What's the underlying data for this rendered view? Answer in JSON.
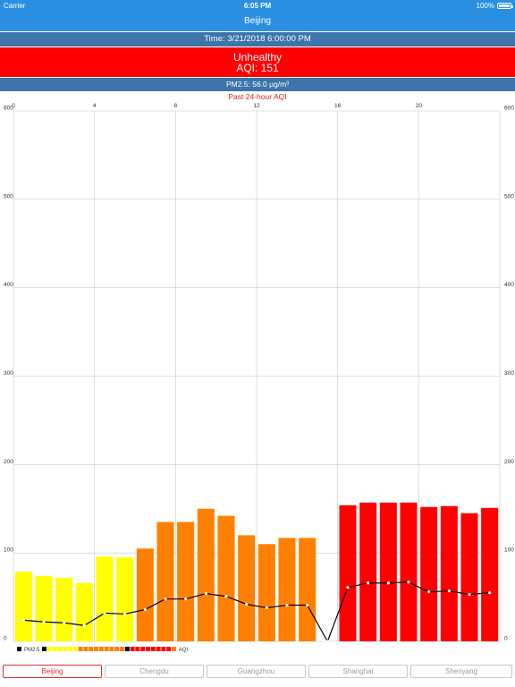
{
  "status_bar": {
    "carrier": "Carrier",
    "time": "6:05 PM",
    "battery": "100%"
  },
  "nav": {
    "title": "Beijing"
  },
  "time_bar": {
    "text": "Time: 3/21/2018 6:00:00 PM"
  },
  "level": {
    "label": "Unhealthy",
    "aqi": "AQI: 151",
    "color": "#ff0000"
  },
  "pm_bar": {
    "text": "PM2.5: 56.0 μg/m³"
  },
  "chart_title": "Past 24-hour AQI",
  "colors": {
    "header_blue": "#2a8fe0",
    "bar_blue": "#3c74ab",
    "good": "#ffff00",
    "moderate": "#ff8000",
    "unhealthy": "#ff0000",
    "accent_red": "#e03030"
  },
  "chart_data": {
    "type": "bar",
    "title": "Past 24-hour AQI",
    "x_ticks": [
      "0",
      "4",
      "8",
      "12",
      "16",
      "20"
    ],
    "y_ticks": [
      "0",
      "100",
      "200",
      "300",
      "400",
      "500",
      "600"
    ],
    "xlim": [
      0,
      24
    ],
    "ylim": [
      0,
      600
    ],
    "grid": true,
    "legend_position": "bottom-left",
    "series": [
      {
        "name": "AQI",
        "type": "bar",
        "x": [
          0,
          1,
          2,
          3,
          4,
          5,
          6,
          7,
          8,
          9,
          10,
          11,
          12,
          13,
          14,
          15,
          16,
          17,
          18,
          19,
          20,
          21,
          22,
          23
        ],
        "values": [
          79,
          74,
          72,
          66,
          96,
          95,
          105,
          135,
          135,
          150,
          142,
          120,
          110,
          117,
          117,
          0,
          154,
          157,
          157,
          157,
          152,
          153,
          145,
          151
        ],
        "colors": [
          "#ffff00",
          "#ffff00",
          "#ffff00",
          "#ffff00",
          "#ffff00",
          "#ffff00",
          "#ff8000",
          "#ff8000",
          "#ff8000",
          "#ff8000",
          "#ff8000",
          "#ff8000",
          "#ff8000",
          "#ff8000",
          "#ff8000",
          "#ff0000",
          "#ff0000",
          "#ff0000",
          "#ff0000",
          "#ff0000",
          "#ff0000",
          "#ff0000",
          "#ff0000",
          "#ff0000"
        ]
      },
      {
        "name": "PM2.5",
        "type": "line",
        "x": [
          0,
          1,
          2,
          3,
          4,
          5,
          6,
          7,
          8,
          9,
          10,
          11,
          12,
          13,
          14,
          15,
          16,
          17,
          18,
          19,
          20,
          21,
          22,
          23
        ],
        "values": [
          24,
          22,
          21,
          18,
          32,
          31,
          36,
          48,
          48,
          54,
          51,
          42,
          38,
          41,
          41,
          0,
          61,
          66,
          66,
          67,
          56,
          57,
          53,
          55
        ]
      }
    ],
    "legend_pm": "PM2.5",
    "legend_aqi": "AQI",
    "legend_swatches": [
      "#000000",
      "#ffff00",
      "#ffff00",
      "#ffff00",
      "#ffff00",
      "#ffff00",
      "#ffff00",
      "#ff8000",
      "#ff8000",
      "#ff8000",
      "#ff8000",
      "#ff8000",
      "#ff8000",
      "#ff8000",
      "#ff8000",
      "#ff8000",
      "#000000",
      "#ff0000",
      "#ff0000",
      "#ff0000",
      "#ff0000",
      "#ff0000",
      "#ff0000",
      "#ff0000",
      "#ff0000",
      "#ff8000"
    ]
  },
  "tabs": [
    {
      "label": "Beijing",
      "active": true
    },
    {
      "label": "Chengdu",
      "active": false
    },
    {
      "label": "Guangzhou",
      "active": false
    },
    {
      "label": "Shanghai",
      "active": false
    },
    {
      "label": "Shenyang",
      "active": false
    }
  ]
}
